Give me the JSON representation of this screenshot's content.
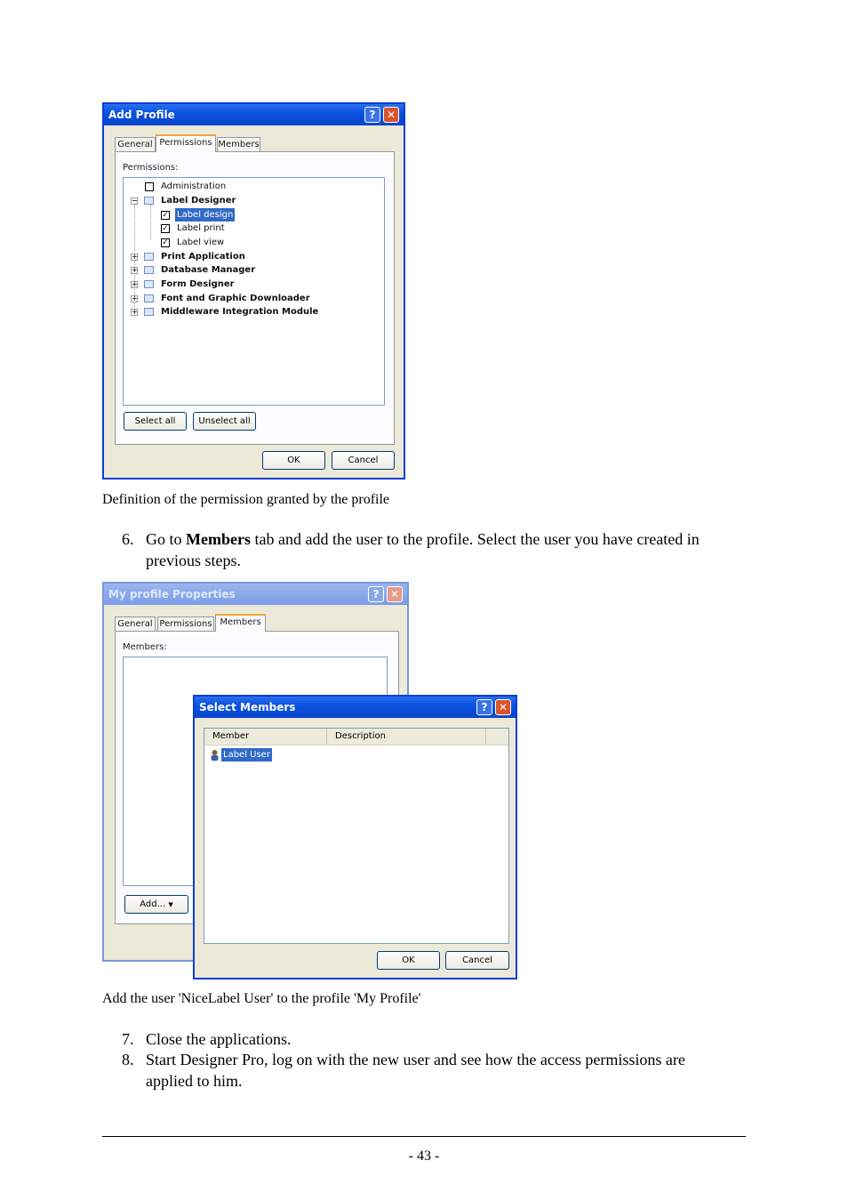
{
  "add_profile_dialog": {
    "title": "Add Profile",
    "help_glyph": "?",
    "close_glyph": "✕",
    "tabs": [
      "General",
      "Permissions",
      "Members"
    ],
    "active_tab": "Permissions",
    "permissions_label": "Permissions:",
    "tree": [
      {
        "label": "Administration",
        "bold": false,
        "checked": false,
        "level": 0
      },
      {
        "label": "Label Designer",
        "bold": true,
        "expanded": true,
        "level": 0
      },
      {
        "label": "Label design",
        "checked": true,
        "selected": true,
        "level": 1
      },
      {
        "label": "Label print",
        "checked": true,
        "level": 1
      },
      {
        "label": "Label view",
        "checked": true,
        "level": 1
      },
      {
        "label": "Print Application",
        "bold": true,
        "expanded": false,
        "level": 0
      },
      {
        "label": "Database Manager",
        "bold": true,
        "expanded": false,
        "level": 0
      },
      {
        "label": "Form Designer",
        "bold": true,
        "expanded": false,
        "level": 0
      },
      {
        "label": "Font and Graphic Downloader",
        "bold": true,
        "expanded": false,
        "level": 0
      },
      {
        "label": "Middleware Integration Module",
        "bold": true,
        "expanded": false,
        "level": 0
      }
    ],
    "select_all": "Select all",
    "unselect_all": "Unselect all",
    "ok": "OK",
    "cancel": "Cancel"
  },
  "caption1": "Definition of the permission granted by the profile",
  "step6": {
    "number": "6.",
    "before": "Go to ",
    "bold": "Members",
    "after": " tab and add the user to the profile. Select the user you have created in previous steps."
  },
  "profile_props_dialog": {
    "title": "My profile Properties",
    "tabs": [
      "General",
      "Permissions",
      "Members"
    ],
    "active_tab": "Members",
    "members_label": "Members:",
    "add_button": "Add...",
    "add_arrow": "▼"
  },
  "select_members_dialog": {
    "title": "Select Members",
    "columns": [
      "Member",
      "Description"
    ],
    "rows": [
      {
        "member": "Label User",
        "description": ""
      }
    ],
    "ok": "OK",
    "cancel": "Cancel"
  },
  "caption2": "Add the user 'NiceLabel User' to the profile 'My Profile'",
  "step7": {
    "number": "7.",
    "text": "Close the applications."
  },
  "step8": {
    "number": "8.",
    "text": "Start Designer Pro, log on with the new user and see how the access permissions are applied to him."
  },
  "page_number": "- 43 -"
}
